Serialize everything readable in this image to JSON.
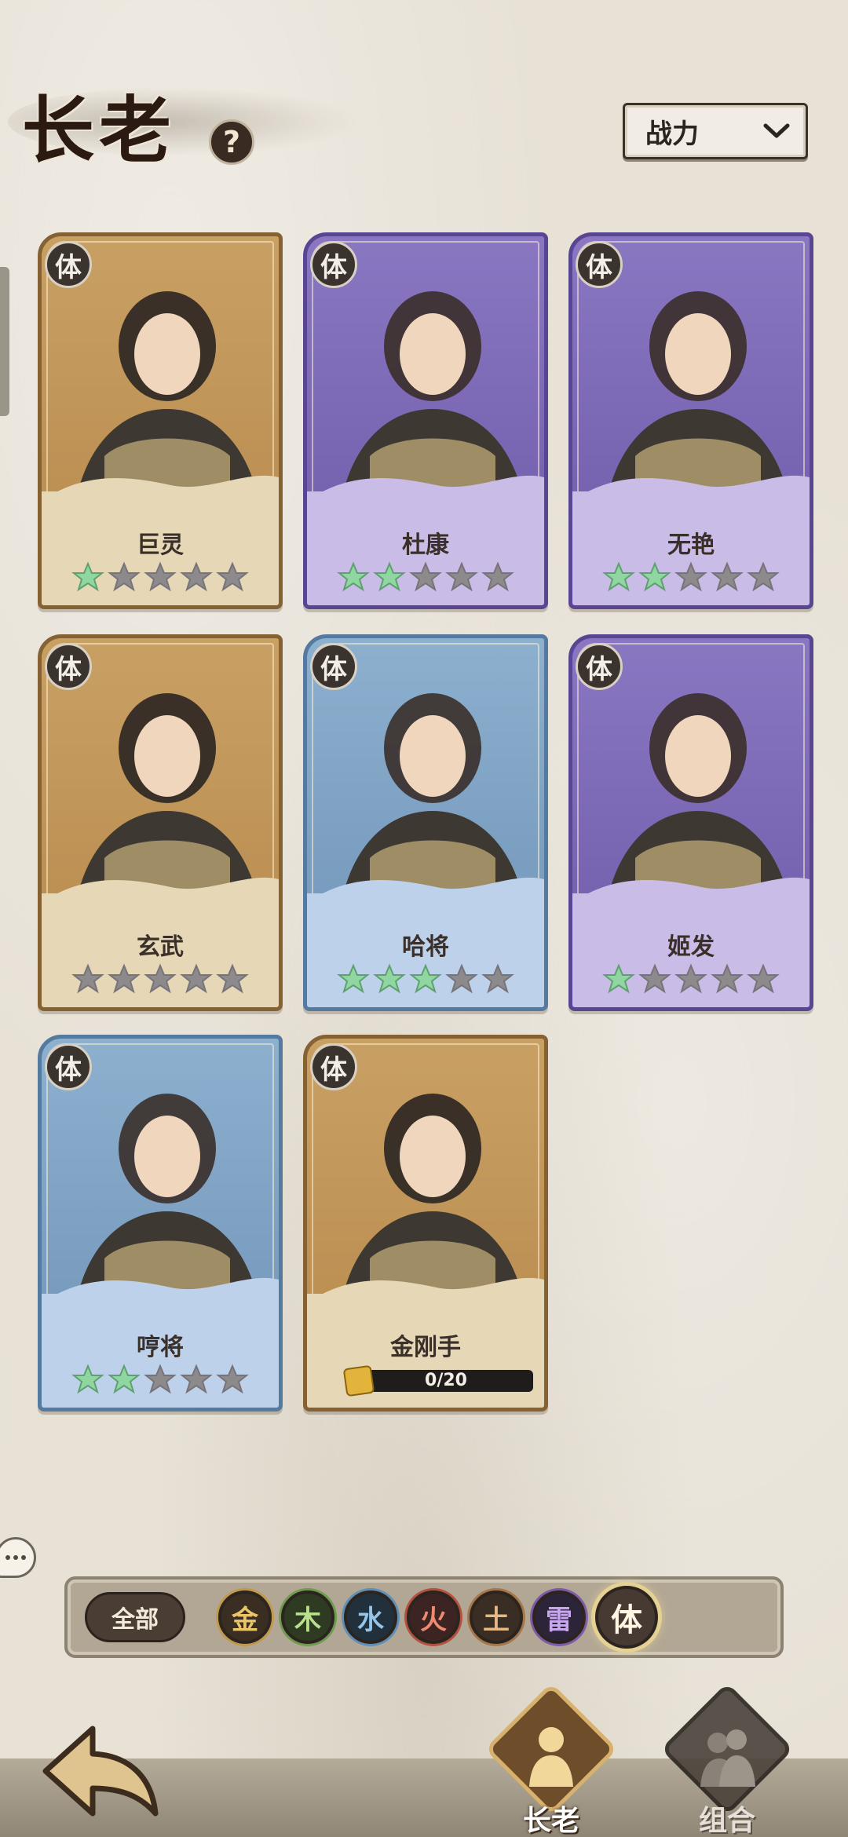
{
  "header": {
    "title": "长老",
    "help_label": "?",
    "sort_dropdown": {
      "selected": "战力"
    }
  },
  "cards": [
    {
      "name": "巨灵",
      "element_badge": "体",
      "frame_color": "gold",
      "stars_filled": 1,
      "stars_total": 5
    },
    {
      "name": "杜康",
      "element_badge": "体",
      "frame_color": "purple",
      "stars_filled": 2,
      "stars_total": 5
    },
    {
      "name": "无艳",
      "element_badge": "体",
      "frame_color": "purple",
      "stars_filled": 2,
      "stars_total": 5
    },
    {
      "name": "玄武",
      "element_badge": "体",
      "frame_color": "gold",
      "stars_filled": 0,
      "stars_total": 5
    },
    {
      "name": "哈将",
      "element_badge": "体",
      "frame_color": "blue",
      "stars_filled": 3,
      "stars_total": 5
    },
    {
      "name": "姬发",
      "element_badge": "体",
      "frame_color": "purple",
      "stars_filled": 1,
      "stars_total": 5
    },
    {
      "name": "哼将",
      "element_badge": "体",
      "frame_color": "blue",
      "stars_filled": 2,
      "stars_total": 5
    },
    {
      "name": "金刚手",
      "element_badge": "体",
      "frame_color": "gold",
      "fragments_text": "0/20",
      "fragments_progress": 0
    }
  ],
  "filter": {
    "all_label": "全部",
    "elements": [
      {
        "label": "金",
        "key": "gold"
      },
      {
        "label": "木",
        "key": "wood"
      },
      {
        "label": "水",
        "key": "water"
      },
      {
        "label": "火",
        "key": "fire"
      },
      {
        "label": "土",
        "key": "earth"
      },
      {
        "label": "雷",
        "key": "thunder"
      },
      {
        "label": "体",
        "key": "body",
        "selected": true
      }
    ]
  },
  "bottom_nav": {
    "tabs": [
      {
        "label": "长老",
        "active": true
      },
      {
        "label": "组合",
        "active": false
      }
    ]
  },
  "colors": {
    "star_filled": "#8fd6a0",
    "star_empty": "#8d8a8c",
    "gold_frame": "#b7894c",
    "purple_frame": "#6e5aa8",
    "blue_frame": "#6f93b7"
  }
}
